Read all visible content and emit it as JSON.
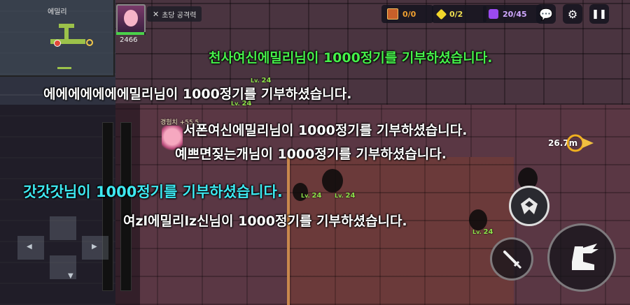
{
  "minimap": {
    "label": "에밀리"
  },
  "hud": {
    "power_value": "2466",
    "attack_label": "초당 공격력",
    "chest_count": "0/0",
    "gem_count": "0/2",
    "puzzle_count": "20/45",
    "hp_fraction": 0.95
  },
  "messages": [
    {
      "name": "천사여신에밀리",
      "rest": "님이 1000정기를 기부하셨습니다."
    },
    {
      "name": "에에에에에에에밀리",
      "rest": "님이 1000정기를 기부하셨습니다."
    },
    {
      "name": "서폰여신에밀리",
      "rest": "님이 1000정기를 기부하셨습니다."
    },
    {
      "name": "예쁘면짖는개",
      "rest": "님이 1000정기를 기부하셨습니다."
    },
    {
      "name": "갓갓갓",
      "rest": "님이 1000정기를 기부하셨습니다."
    },
    {
      "name": "여zl에밀리lz신",
      "rest": "님이 1000정기를 기부하셨습니다."
    }
  ],
  "levels": {
    "prefix": "Lv.",
    "value": "24"
  },
  "player": {
    "exp_label": "경험치 +55.5"
  },
  "waypoint": {
    "distance": "26.7m"
  },
  "icons": {
    "attack": "crossed-swords-icon",
    "chest": "chest-icon",
    "gem": "gem-icon",
    "puzzle": "puzzle-icon",
    "chat": "chat-icon",
    "settings": "gear-icon",
    "pause": "pause-icon",
    "emblem": "emblem-icon",
    "sword": "sword-icon",
    "dash": "winged-boot-icon"
  },
  "colors": {
    "green_msg": "#46f04a",
    "cyan_msg": "#3ee8f0",
    "level_green": "#8de04a"
  }
}
